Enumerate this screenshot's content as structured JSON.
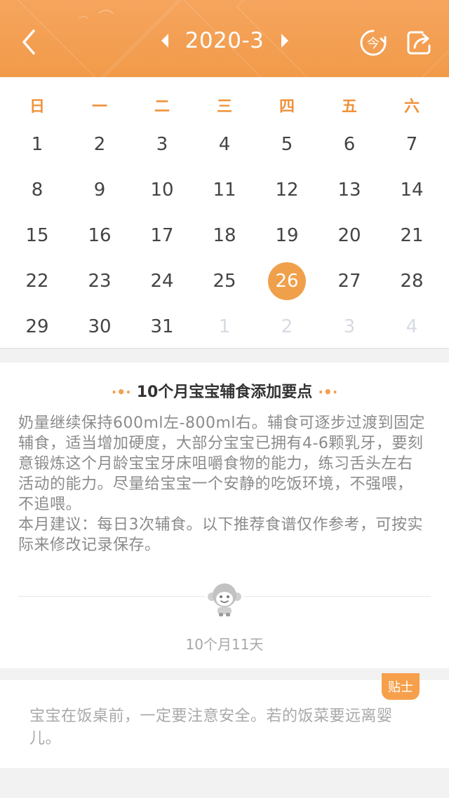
{
  "header": {
    "month_title": "2020-3",
    "icons": {
      "back": "chevron-left-icon",
      "prev_month": "caret-left-icon",
      "next_month": "caret-right-icon",
      "today": "today-icon",
      "share": "share-icon"
    },
    "today_glyph": "今"
  },
  "colors": {
    "accent": "#f19a49",
    "weekday": "#f0923b",
    "selected_day_bg": "#f0a04b",
    "dim_day": "#d6dbe2",
    "body_text": "#8b8b8b"
  },
  "calendar": {
    "weekdays": [
      "日",
      "一",
      "二",
      "三",
      "四",
      "五",
      "六"
    ],
    "weeks": [
      [
        {
          "d": "1"
        },
        {
          "d": "2"
        },
        {
          "d": "3"
        },
        {
          "d": "4"
        },
        {
          "d": "5"
        },
        {
          "d": "6"
        },
        {
          "d": "7"
        }
      ],
      [
        {
          "d": "8"
        },
        {
          "d": "9"
        },
        {
          "d": "10"
        },
        {
          "d": "11"
        },
        {
          "d": "12"
        },
        {
          "d": "13"
        },
        {
          "d": "14"
        }
      ],
      [
        {
          "d": "15"
        },
        {
          "d": "16"
        },
        {
          "d": "17"
        },
        {
          "d": "18"
        },
        {
          "d": "19"
        },
        {
          "d": "20"
        },
        {
          "d": "21"
        }
      ],
      [
        {
          "d": "22"
        },
        {
          "d": "23"
        },
        {
          "d": "24"
        },
        {
          "d": "25"
        },
        {
          "d": "26",
          "selected": true
        },
        {
          "d": "27"
        },
        {
          "d": "28"
        }
      ],
      [
        {
          "d": "29"
        },
        {
          "d": "30"
        },
        {
          "d": "31"
        },
        {
          "d": "1",
          "dim": true
        },
        {
          "d": "2",
          "dim": true
        },
        {
          "d": "3",
          "dim": true
        },
        {
          "d": "4",
          "dim": true
        }
      ]
    ]
  },
  "article": {
    "title": "10个月宝宝辅食添加要点",
    "paragraphs": [
      "奶量继续保持600ml左-800ml右。辅食可逐步过渡到固定辅食，适当增加硬度，大部分宝宝已拥有4-6颗乳牙，要刻意锻炼这个月龄宝宝牙床咀嚼食物的能力，练习舌头左右活动的能力。尽量给宝宝一个安静的吃饭环境，不强喂，不追喂。",
      "本月建议：每日3次辅食。以下推荐食谱仅作参考，可按实际来修改记录保存。"
    ],
    "mascot_icon": "monkey-mascot-icon",
    "age_label": "10个月11天"
  },
  "tip": {
    "badge": "贴士",
    "text": "宝宝在饭桌前，一定要注意安全。若的饭菜要远离婴儿。"
  }
}
